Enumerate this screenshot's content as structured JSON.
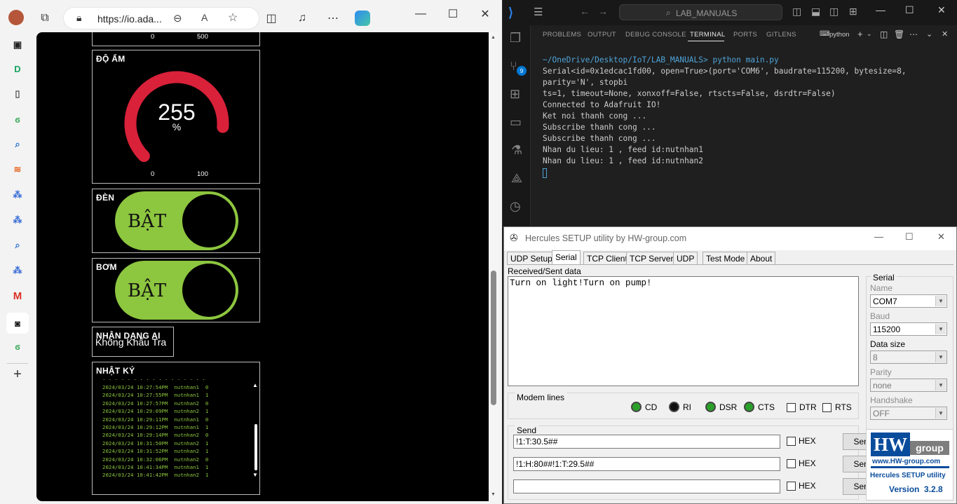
{
  "browser": {
    "url": "https://io.ada...",
    "gauge_top_partial": {
      "min": "0",
      "max": "500"
    },
    "humidity": {
      "title": "ĐỘ ẨM",
      "value": "255",
      "unit": "%",
      "min": "0",
      "max": "100",
      "fraction": 0.85,
      "color": "#d9213a"
    },
    "light": {
      "title": "ĐÈN",
      "state": "BẬT"
    },
    "pump": {
      "title": "BƠM",
      "state": "BẬT"
    },
    "ai": {
      "title": "NHẬN DẠNG AI",
      "value": "Không Khẩu Tra"
    },
    "log": {
      "title": "NHẬT KÝ",
      "rows": [
        "2024/03/24 10:27:54PM  nutnhan1  0",
        "2024/03/24 10:27:55PM  nutnhan1  1",
        "2024/03/24 10:27:57PM  nutnhan2  0",
        "2024/03/24 10:29:09PM  nutnhan2  1",
        "2024/03/24 10:29:11PM  nutnhan1  0",
        "2024/03/24 10:29:12PM  nutnhan1  1",
        "2024/03/24 10:29:14PM  nutnhan2  0",
        "2024/03/24 10:31:50PM  nutnhan2  1",
        "2024/03/24 10:31:52PM  nutnhan2  1",
        "2024/03/24 10:32:06PM  nutnhan2  0",
        "2024/03/24 10:41:34PM  nutnhan1  1",
        "2024/03/24 10:41:42PM  nutnhan2  1"
      ]
    },
    "accent_green": "#8dc63f"
  },
  "vscode": {
    "search": "LAB_MANUALS",
    "tabs": [
      "PROBLEMS",
      "OUTPUT",
      "DEBUG CONSOLE",
      "TERMINAL",
      "PORTS",
      "GITLENS"
    ],
    "active_tab": "TERMINAL",
    "shell": "python",
    "badge": "9",
    "terminal": [
      "~/OneDrive/Desktop/IoT/LAB_MANUALS> python main.py",
      "Serial<id=0x1edcac1fd00, open=True>(port='COM6', baudrate=115200, bytesize=8, parity='N', stopbi",
      "ts=1, timeout=None, xonxoff=False, rtscts=False, dsrdtr=False)",
      "Connected to Adafruit IO!",
      "Ket noi thanh cong ...",
      "Subscribe thanh cong ...",
      "Subscribe thanh cong ...",
      "Nhan du lieu: 1 , feed id:nutnhan1",
      "Nhan du lieu: 1 , feed id:nutnhan2"
    ]
  },
  "hercules": {
    "title": "Hercules SETUP utility by HW-group.com",
    "tabs": [
      "UDP Setup",
      "Serial",
      "TCP Client",
      "TCP Server",
      "UDP",
      "Test Mode",
      "About"
    ],
    "active_tab": "Serial",
    "received_label": "Received/Sent data",
    "received": "Turn on light!Turn on pump!",
    "modem_label": "Modem lines",
    "modem": {
      "cd": "CD",
      "ri": "RI",
      "dsr": "DSR",
      "cts": "CTS",
      "dtr": "DTR",
      "rts": "RTS"
    },
    "send_label": "Send",
    "send_rows": [
      {
        "value": "!1:T:30.5##",
        "hex": "HEX",
        "button": "Send"
      },
      {
        "value": "!1:H:80##!1:T:29.5##",
        "hex": "HEX",
        "button": "Send"
      },
      {
        "value": "",
        "hex": "HEX",
        "button": "Send"
      }
    ],
    "serial": {
      "group": "Serial",
      "name_label": "Name",
      "name": "COM7",
      "baud_label": "Baud",
      "baud": "115200",
      "datasize_label": "Data size",
      "datasize": "8",
      "parity_label": "Parity",
      "parity": "none",
      "handshake_label": "Handshake",
      "handshake": "OFF"
    },
    "logo": {
      "hw": "HW",
      "group": "group",
      "site": "www.HW-group.com",
      "product": "Hercules SETUP utility",
      "version": "Version  3.2.8"
    }
  }
}
